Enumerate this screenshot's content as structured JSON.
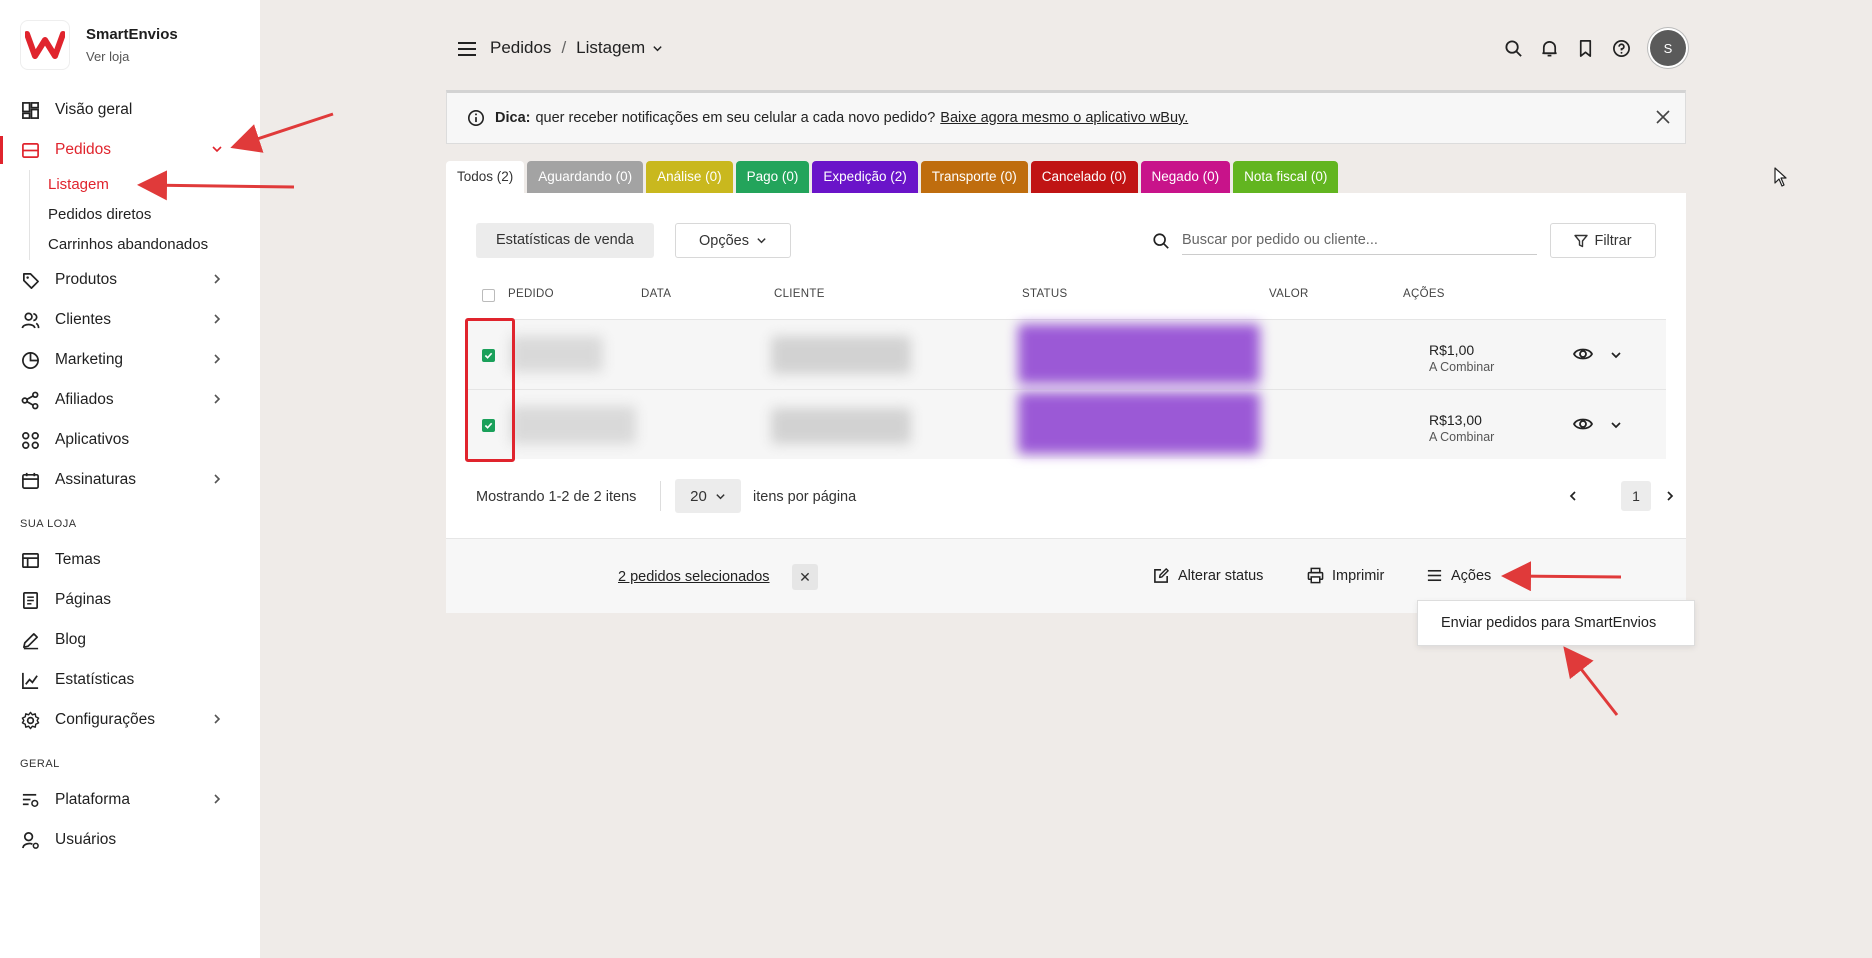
{
  "brand": {
    "name": "SmartEnvios",
    "sub": "Ver loja"
  },
  "nav": {
    "visao_geral": "Visão geral",
    "pedidos": "Pedidos",
    "pedidos_sub": [
      "Listagem",
      "Pedidos diretos",
      "Carrinhos abandonados"
    ],
    "produtos": "Produtos",
    "clientes": "Clientes",
    "marketing": "Marketing",
    "afiliados": "Afiliados",
    "aplicativos": "Aplicativos",
    "assinaturas": "Assinaturas",
    "section_loja": "SUA LOJA",
    "temas": "Temas",
    "paginas": "Páginas",
    "blog": "Blog",
    "estatisticas": "Estatísticas",
    "configuracoes": "Configurações",
    "section_geral": "GERAL",
    "plataforma": "Plataforma",
    "usuarios": "Usuários"
  },
  "breadcrumb": {
    "root": "Pedidos",
    "sep": "/",
    "current": "Listagem"
  },
  "avatar": "S",
  "tip": {
    "label": "Dica:",
    "text": "quer receber notificações em seu celular a cada novo pedido?",
    "link": "Baixe agora mesmo o aplicativo wBuy."
  },
  "tabs": [
    {
      "label": "Todos (2)",
      "color": "#ffffff"
    },
    {
      "label": "Aguardando (0)",
      "color": "#a3a3a3"
    },
    {
      "label": "Análise (0)",
      "color": "#c9b81e"
    },
    {
      "label": "Pago (0)",
      "color": "#23a45b"
    },
    {
      "label": "Expedição (2)",
      "color": "#6a14c9"
    },
    {
      "label": "Transporte (0)",
      "color": "#bf6d0e"
    },
    {
      "label": "Cancelado (0)",
      "color": "#c01414"
    },
    {
      "label": "Negado (0)",
      "color": "#c8138a"
    },
    {
      "label": "Nota fiscal (0)",
      "color": "#62b520"
    }
  ],
  "toolbar": {
    "stats": "Estatísticas de venda",
    "opcoes": "Opções",
    "search_placeholder": "Buscar por pedido ou cliente...",
    "filtrar": "Filtrar"
  },
  "table": {
    "headers": [
      "PEDIDO",
      "DATA",
      "CLIENTE",
      "STATUS",
      "VALOR",
      "AÇÕES"
    ],
    "rows": [
      {
        "valor": "R$1,00",
        "frete": "A Combinar"
      },
      {
        "valor": "R$13,00",
        "frete": "A Combinar"
      }
    ]
  },
  "pager": {
    "showing": "Mostrando 1-2 de 2 itens",
    "per_page": "20",
    "per_label": "itens por página",
    "page": "1"
  },
  "actionbar": {
    "selected": "2 pedidos selecionados",
    "clear": "✕",
    "alterar": "Alterar status",
    "imprimir": "Imprimir",
    "acoes": "Ações"
  },
  "dropdown": {
    "item": "Enviar pedidos para SmartEnvios"
  },
  "colors": {
    "accent": "#e0242d",
    "check": "#1aa05a",
    "annotation": "#e03a3a"
  }
}
